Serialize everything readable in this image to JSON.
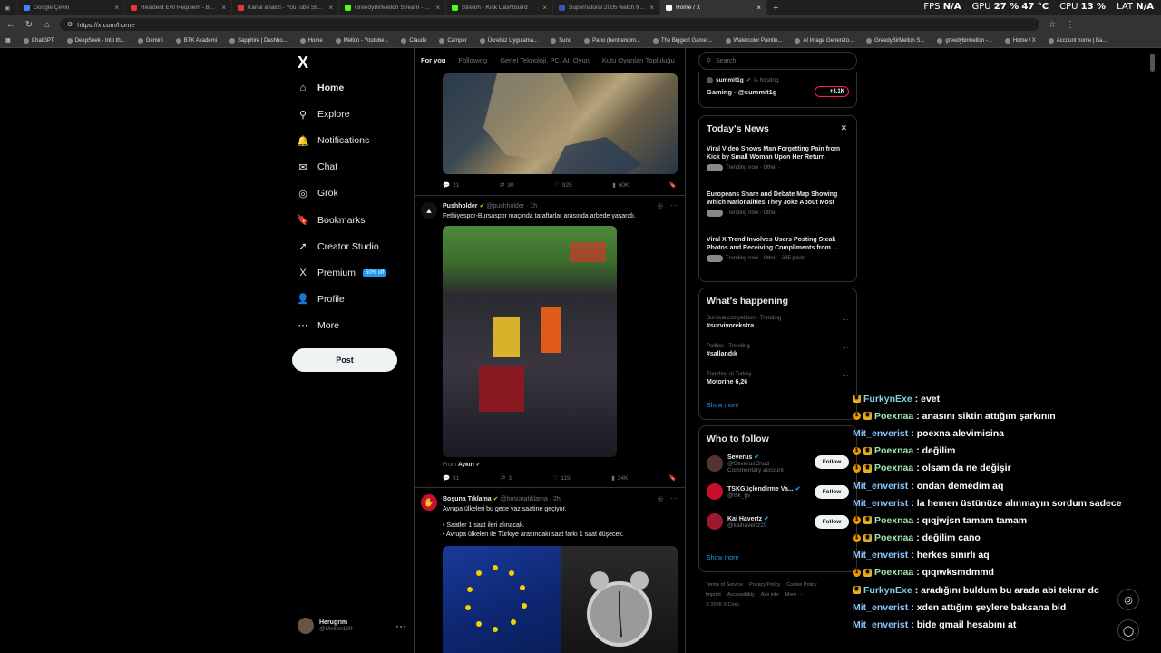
{
  "browser": {
    "tabs": [
      {
        "title": "Google Çeviri",
        "color": "#4285f4",
        "active": false
      },
      {
        "title": "Resident Evil Requiem - Bölüm 5",
        "color": "#e53935",
        "active": false
      },
      {
        "title": "Kanal analizi - YouTube Studio",
        "color": "#e53935",
        "active": false
      },
      {
        "title": "GreedyBirMellon Stream - Watch",
        "color": "#53fc18",
        "active": false
      },
      {
        "title": "Stream - Kick Dashboard",
        "color": "#53fc18",
        "active": false
      },
      {
        "title": "Supernatural 2005 watch free - 11",
        "color": "#3f51b5",
        "active": false
      },
      {
        "title": "Home / X",
        "color": "#ffffff",
        "active": true
      }
    ],
    "url": "https://x.com/home",
    "bookmarks": [
      "ChatGPT",
      "DeepSeek - Into th...",
      "Gemini",
      "BTK Akademi",
      "Sapphire | Dashbo...",
      "Home",
      "Mellon - Youtube...",
      "Claude",
      "Camper",
      "Ücretsiz Uygulama...",
      "Suno",
      "Pano (bentrendim...",
      "The Biggest Gamer...",
      "Watercolor Paintin...",
      "AI Image Generato...",
      "GreedyBirMellon S...",
      "greedybirmellon -...",
      "Home / X",
      "Account home | Ba..."
    ]
  },
  "hud": {
    "fps_label": "FPS",
    "fps": "N/A",
    "gpu_label": "GPU",
    "gpu": "27 %",
    "gpu_temp": "47 °C",
    "cpu_label": "CPU",
    "cpu": "13 %",
    "lat_label": "LAT",
    "lat": "N/A"
  },
  "sidebar": {
    "logo": "X",
    "items": [
      {
        "label": "Home",
        "icon": "home-icon"
      },
      {
        "label": "Explore",
        "icon": "search-icon"
      },
      {
        "label": "Notifications",
        "icon": "bell-icon"
      },
      {
        "label": "Chat",
        "icon": "mail-icon"
      },
      {
        "label": "Grok",
        "icon": "grok-icon"
      },
      {
        "label": "Bookmarks",
        "icon": "bookmark-icon"
      },
      {
        "label": "Creator Studio",
        "icon": "rocket-icon"
      },
      {
        "label": "Premium",
        "icon": "x-icon"
      },
      {
        "label": "Profile",
        "icon": "person-icon"
      },
      {
        "label": "More",
        "icon": "more-icon"
      }
    ],
    "premium_badge": "50% off",
    "post_label": "Post",
    "account": {
      "name": "Herugrim",
      "handle": "@Mellon199"
    }
  },
  "feed": {
    "tabs": [
      "For you",
      "Following",
      "Genel Teknoloji, PC, AI, Oyun",
      "Kutu Oyunları Topluluğu"
    ],
    "post0": {
      "replies": "21",
      "reposts": "30",
      "likes": "925",
      "views": "60K"
    },
    "post1": {
      "name": "Pushholder",
      "handle": "@pushholder",
      "time": "· 1h",
      "text": "Fethiyespor-Bursaspor maçında taraftarlar arasında arbede yaşandı.",
      "from_label": "From",
      "from_name": "Aykırı",
      "replies": "51",
      "reposts": "3",
      "likes": "115",
      "views": "34K"
    },
    "post2": {
      "name": "Boşuna Tıklama",
      "handle": "@bosunatiklama",
      "time": "· 2h",
      "line1": "Avrupa ülkeleri bu gece yaz saatine geçiyor.",
      "line2": "• Saatler 1 saat ileri alınacak.",
      "line3": "• Avrupa ülkeleri ile Türkiye arasındaki saat farkı 1 saat düşecek."
    }
  },
  "right": {
    "search_placeholder": "Search",
    "live": {
      "user": "summit1g",
      "hosting": "is hosting",
      "title": "Gaming - @summit1g",
      "count": "+3.1K"
    },
    "news": {
      "title": "Today's News",
      "items": [
        {
          "title": "Viral Video Shows Man Forgetting Pain from Kick by Small Woman Upon Her Return",
          "meta": "Trending now · Other ·"
        },
        {
          "title": "Europeans Share and Debate Map Showing Which Nationalities They Joke About Most",
          "meta": "Trending now · Other ·"
        },
        {
          "title": "Viral X Trend Involves Users Posting Steak Photos and Receiving Compliments from ...",
          "meta": "Trending now · Other · 235 posts"
        }
      ]
    },
    "happening": {
      "title": "What's happening",
      "items": [
        {
          "category": "Survival competition · Trending",
          "tag": "#survivorekstra"
        },
        {
          "category": "Politics · Trending",
          "tag": "#sallandık"
        },
        {
          "category": "Trending in Turkey",
          "tag": "Motorine 6,26"
        }
      ],
      "show_more": "Show more"
    },
    "follow": {
      "title": "Who to follow",
      "items": [
        {
          "name": "Severus",
          "handle": "@SeverusChud",
          "note": "Commentary account"
        },
        {
          "name": "TSKGüçlendirme Va...",
          "handle": "@tsk_gv",
          "note": ""
        },
        {
          "name": "Kai Havertz",
          "handle": "@kaihavertz29",
          "note": ""
        }
      ],
      "button": "Follow",
      "show_more": "Show more"
    },
    "footer": [
      "Terms of Service",
      "Privacy Policy",
      "Cookie Policy",
      "Imprint",
      "Accessibility",
      "Ads info",
      "More ···",
      "© 2026 X Corp."
    ]
  },
  "chat": [
    {
      "user": "FurkynExe",
      "msg": ": evet",
      "badge": "crown",
      "style": "f"
    },
    {
      "user": "Poexnaa",
      "msg": ": anasını siktin attığım şarkının",
      "badge": "both",
      "style": "p"
    },
    {
      "user": "Mit_enverist",
      "msg": ": poexna alevimisina",
      "badge": "none",
      "style": "m"
    },
    {
      "user": "Poexnaa",
      "msg": ": değilim",
      "badge": "both",
      "style": "p"
    },
    {
      "user": "Poexnaa",
      "msg": ": olsam da ne değişir",
      "badge": "both",
      "style": "p"
    },
    {
      "user": "Mit_enverist",
      "msg": ": ondan demedim aq",
      "badge": "none",
      "style": "m"
    },
    {
      "user": "Mit_enverist",
      "msg": ": la hemen üstünüze alınmayın sordum sadece",
      "badge": "none",
      "style": "m"
    },
    {
      "user": "Poexnaa",
      "msg": ": qıqjwjsn tamam tamam",
      "badge": "both",
      "style": "p"
    },
    {
      "user": "Poexnaa",
      "msg": ": değilim cano",
      "badge": "both",
      "style": "p"
    },
    {
      "user": "Mit_enverist",
      "msg": ": herkes sınırlı aq",
      "badge": "none",
      "style": "m"
    },
    {
      "user": "Poexnaa",
      "msg": ": qıqıwksmdmmd",
      "badge": "both",
      "style": "p"
    },
    {
      "user": "FurkynExe",
      "msg": ": aradığını buldum bu arada abi tekrar dc",
      "badge": "crown",
      "style": "f"
    },
    {
      "user": "Mit_enverist",
      "msg": ": xden attığım şeylere baksana bid",
      "badge": "none",
      "style": "m"
    },
    {
      "user": "Mit_enverist",
      "msg": ": bide gmail hesabını at",
      "badge": "none",
      "style": "m"
    }
  ]
}
